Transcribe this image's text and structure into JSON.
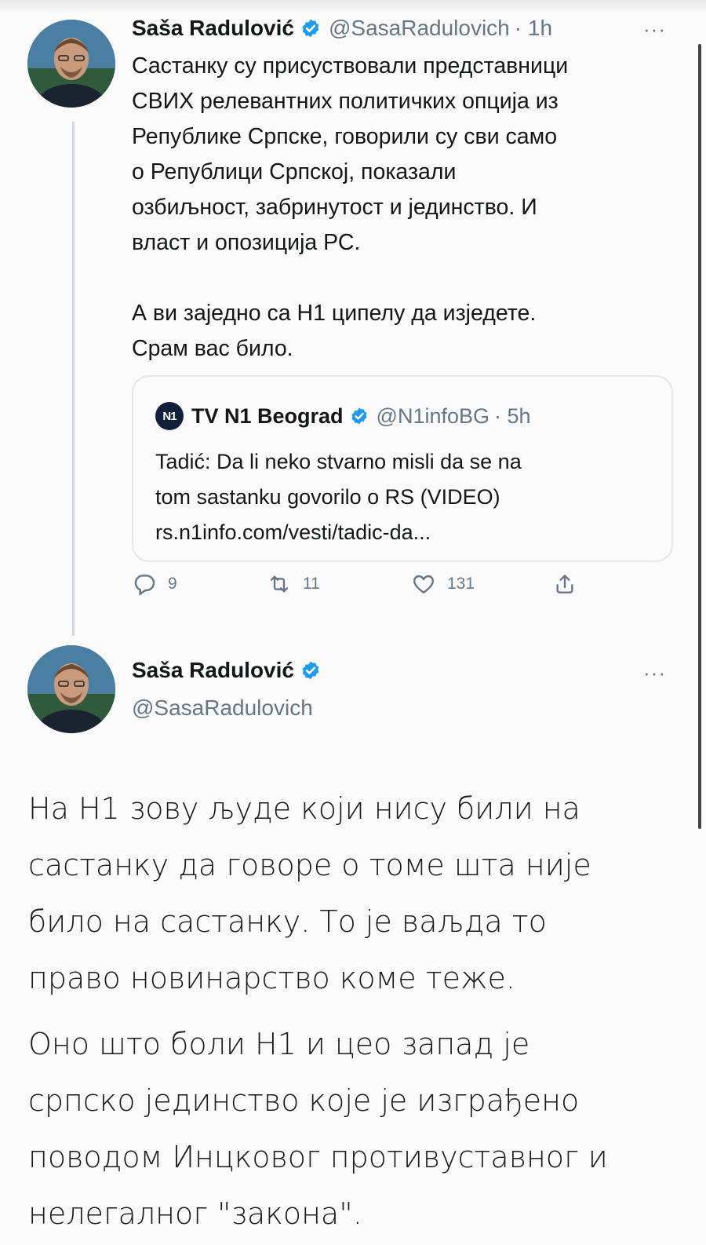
{
  "tweet1": {
    "name": "Saša Radulović",
    "handle": "@SasaRadulovich",
    "time": "· 1h",
    "more": "···",
    "paragraph1": [
      "Састанку су присуствовали представници",
      "СВИХ релевантних политичких опција из",
      "Републике Српске, говорили су сви само",
      "о Републици Српској, показали",
      "озбиљност, забринутост и јединство. И",
      "власт и опозиција РС."
    ],
    "paragraph2": [
      "А ви заједно са Н1 ципелу да изједете.",
      "Срам вас било."
    ],
    "quote": {
      "logo": "N1",
      "name": "TV N1 Beograd",
      "handle": "@N1infoBG",
      "time": "· 5h",
      "lines": [
        "Tadić: Da li neko stvarno misli da se na",
        "tom sastanku govorilo o RS (VIDEO)",
        "rs.n1info.com/vesti/tadic-da..."
      ]
    },
    "actions": {
      "reply_count": "9",
      "retweet_count": "11",
      "like_count": "131"
    }
  },
  "tweet2": {
    "name": "Saša Radulović",
    "handle": "@SasaRadulovich",
    "more": "···",
    "paragraph1": [
      "На Н1 зову људе који нису били на",
      "састанку да говоре о томе шта није",
      "било на састанку. То је ваљда то",
      "право новинарство коме теже."
    ],
    "paragraph2": [
      "Оно што боли Н1 и цео запад је",
      "српско јединство које је изграђено",
      "поводом Инцковог противуставног и",
      "нелегалног \"закона\"."
    ]
  },
  "colors": {
    "verified": "#1d9bf0",
    "secondary_text": "#657786",
    "border": "#e1e8ed"
  },
  "icons": [
    "verified-badge-icon",
    "reply-icon",
    "retweet-icon",
    "like-icon",
    "share-icon",
    "more-icon"
  ]
}
